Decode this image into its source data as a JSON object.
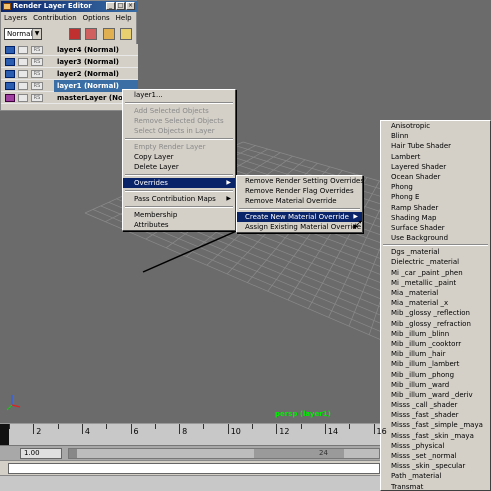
{
  "render_layer_editor": {
    "title": "Render Layer Editor",
    "window_buttons": [
      "_",
      "□",
      "×"
    ],
    "menus": [
      "Layers",
      "Contribution",
      "Options",
      "Help"
    ],
    "mode_select": "Normal",
    "layers": [
      {
        "name": "layer4 (Normal)",
        "selected": false
      },
      {
        "name": "layer3 (Normal)",
        "selected": false
      },
      {
        "name": "layer2 (Normal)",
        "selected": false
      },
      {
        "name": "layer1 (Normal)",
        "selected": true
      },
      {
        "name": "masterLayer (Normal)",
        "selected": false
      }
    ]
  },
  "context_menu": {
    "layer_label": "layer1...",
    "add_selected": "Add Selected Objects",
    "remove_selected": "Remove Selected Objects",
    "select_objects": "Select Objects in Layer",
    "empty_layer": "Empty Render Layer",
    "copy_layer": "Copy Layer",
    "delete_layer": "Delete Layer",
    "overrides": "Overrides",
    "pass_maps": "Pass Contribution Maps",
    "membership": "Membership",
    "attributes": "Attributes"
  },
  "overrides_menu": {
    "remove_render": "Remove Render Setting Overrides",
    "remove_flag": "Remove Render Flag Overrides",
    "remove_material": "Remove Material Override",
    "create_material": "Create New Material Override",
    "assign_material": "Assign Existing Material Override"
  },
  "materials_menu": {
    "maya": [
      "Anisotropic",
      "Blinn",
      "Hair Tube Shader",
      "Lambert",
      "Layered Shader",
      "Ocean Shader",
      "Phong",
      "Phong E",
      "Ramp Shader",
      "Shading Map",
      "Surface Shader",
      "Use Background"
    ],
    "mental_ray": [
      "Dgs _material",
      "Dielectric _material",
      "Mi _car _paint _phen",
      "Mi _metallic _paint",
      "Mia _material",
      "Mia _material _x",
      "Mib _glossy _reflection",
      "Mib _glossy _refraction",
      "Mib _illum _blinn",
      "Mib _illum _cooktorr",
      "Mib _illum _hair",
      "Mib _illum _lambert",
      "Mib _illum _phong",
      "Mib _illum _ward",
      "Mib _illum _ward _deriv",
      "Misss _call _shader",
      "Misss _fast _shader",
      "Misss _fast _simple _maya",
      "Misss _fast _skin _maya",
      "Misss _physical",
      "Misss _set _normal",
      "Misss _skin _specular",
      "Path _material",
      "Transmat"
    ]
  },
  "viewport": {
    "camera_label": "persp (layer1)"
  },
  "timeline": {
    "ticks": [
      "2",
      "4",
      "6",
      "8",
      "10",
      "12",
      "14",
      "16"
    ],
    "current_frame": 1
  },
  "range": {
    "start_value": "1.00",
    "range_end": "24"
  },
  "colors": {
    "highlight": "#0a246a",
    "selected_layer": "#3a6ea5",
    "camera_label": "#00ee00"
  }
}
